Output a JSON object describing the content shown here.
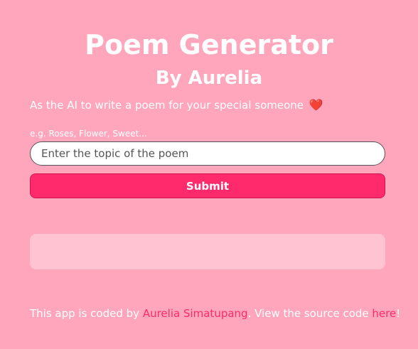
{
  "header": {
    "title": "Poem Generator",
    "subtitle": "By Aurelia"
  },
  "intro": {
    "text": "As the AI to write a poem for your special someone",
    "emoji": "❤️"
  },
  "form": {
    "hint": "e.g. Roses, Flower, Sweet...",
    "input_placeholder": "Enter the topic of the poem",
    "input_value": "",
    "submit_label": "Submit"
  },
  "output": {
    "text": ""
  },
  "footer": {
    "prefix": "This app is coded by ",
    "author_link": "Aurelia Simatupang",
    "middle": ". View the source code ",
    "source_link": "here",
    "suffix": "!"
  },
  "colors": {
    "background": "#ffa6bd",
    "accent": "#ff2a6b",
    "output_box": "#ffc3d2",
    "text": "#ffffff"
  }
}
